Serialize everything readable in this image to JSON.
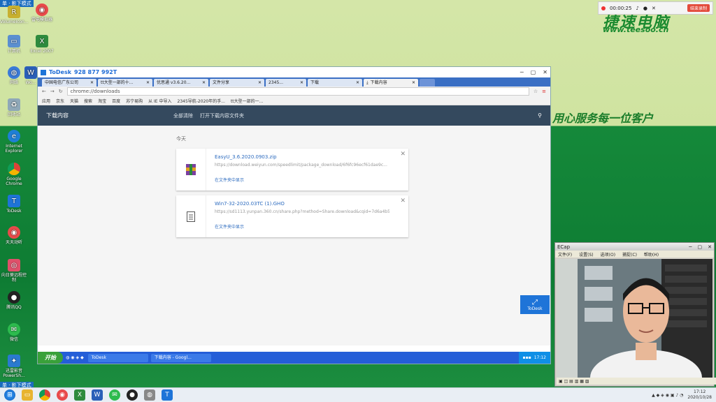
{
  "desktop": {
    "corner_label_top": "单 · 影下模式",
    "corner_label_bottom": "单 · 影下模式",
    "watermark_title": "捷速电脑",
    "watermark_url": "www.teesoo.cn",
    "slogan": "用心服务每一位客户",
    "icons": [
      {
        "label": "VolumeIcon..."
      },
      {
        "label": "雷电模拟器"
      },
      {
        "label": "计算机"
      },
      {
        "label": "Excel 2007"
      },
      {
        "label": "网络"
      },
      {
        "label": "Wo..."
      },
      {
        "label": "回收站"
      },
      {
        "label": "Internet Explorer"
      },
      {
        "label": "Google Chrome"
      },
      {
        "label": "ToDesk"
      },
      {
        "label": "天天动听"
      },
      {
        "label": "向日葵远程控制"
      },
      {
        "label": "腾讯QQ"
      },
      {
        "label": "微信"
      },
      {
        "label": "迅雷影音 PowerSh..."
      }
    ]
  },
  "recorder": {
    "time": "00:00:25",
    "stop_label": "结束录制"
  },
  "todesk": {
    "app_name": "ToDesk",
    "device_id": "928 877 992T"
  },
  "browser": {
    "tabs": [
      {
        "label": "中国电信广东公司"
      },
      {
        "label": "tt大型一部的十..."
      },
      {
        "label": "优思通 v3.6.20..."
      },
      {
        "label": "文件分享"
      },
      {
        "label": "2345..."
      },
      {
        "label": "下载"
      },
      {
        "label": "下载内容",
        "active": true
      }
    ],
    "url": "chrome://downloads",
    "bookmarks": [
      "应用",
      "京东",
      "天猫",
      "搜索",
      "淘宝",
      "百度",
      "苏宁易购",
      "从 IE 中导入",
      "2345导航-2020年的手...",
      "tt大型一部的一..."
    ]
  },
  "downloads": {
    "title": "下载内容",
    "clear_all": "全部清除",
    "open_folder": "打开下载内容文件夹",
    "section_today": "今天",
    "items": [
      {
        "name": "EasyU_3.6.2020.0903.zip",
        "url": "https://download.weiyun.com/speedlimit/package_download/6f6fc96ecf61dae9c...",
        "action": "在文件夹中显示",
        "icon": "winrar-archive-icon"
      },
      {
        "name": "Win7-32-2020.03TC (1).GHO",
        "url": "https://sd1113.yunpan.360.cn/share.php?method=Share.download&cqid=7d6a4b5...",
        "action": "在文件夹中显示",
        "icon": "document-file-icon"
      }
    ]
  },
  "remote_taskbar": {
    "start": "开始",
    "buttons": [
      "ToDesk",
      "下载内容 - Googl..."
    ],
    "time": "17:12"
  },
  "side_button": {
    "label": "ToDesk"
  },
  "ecap": {
    "title": "ECap",
    "menu": [
      "文件(F)",
      "设置(S)",
      "选项(O)",
      "捕捉(C)",
      "帮助(H)"
    ]
  },
  "taskbar": {
    "time": "17:12",
    "date": "2020/10/28"
  }
}
